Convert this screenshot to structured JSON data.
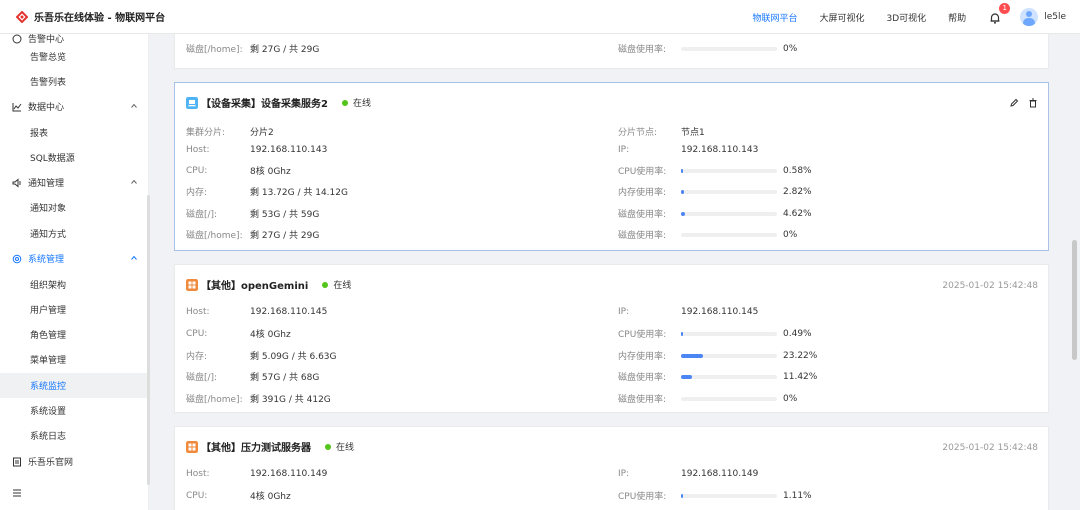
{
  "header": {
    "brand": "乐吾乐在线体验 - 物联网平台",
    "nav": [
      "物联网平台",
      "大屏可视化",
      "3D可视化",
      "帮助"
    ],
    "active_nav": 0,
    "notifications": "1",
    "username": "le5le"
  },
  "sidebar": {
    "groups": [
      {
        "label": "告警中心",
        "items": [
          "告警总览",
          "告警列表"
        ]
      },
      {
        "label": "数据中心",
        "items": [
          "报表",
          "SQL数据源"
        ]
      },
      {
        "label": "通知管理",
        "items": [
          "通知对象",
          "通知方式"
        ]
      },
      {
        "label": "系统管理",
        "items": [
          "组织架构",
          "用户管理",
          "角色管理",
          "菜单管理",
          "系统监控",
          "系统设置",
          "系统日志"
        ]
      },
      {
        "label": "乐吾乐官网",
        "items": []
      }
    ]
  },
  "labels": {
    "cluster": "集群分片:",
    "node": "分片节点:",
    "host": "Host:",
    "ip": "IP:",
    "cpu": "CPU:",
    "cpu_usage": "CPU使用率:",
    "mem": "内存:",
    "mem_usage": "内存使用率:",
    "disk_root": "磁盘[/]:",
    "disk_home": "磁盘[/home]:",
    "disk_usage": "磁盘使用率:",
    "online": "在线"
  },
  "card0": {
    "disk_home": "剩 27G  /  共 29G",
    "disk_home_pct": "0%",
    "disk_home_fill": 0
  },
  "card1": {
    "title": "【设备采集】设备采集服务2",
    "status": "在线",
    "cluster": "分片2",
    "node": "节点1",
    "host": "192.168.110.143",
    "ip": "192.168.110.143",
    "cpu": "8核  0Ghz",
    "cpu_pct": "0.58%",
    "cpu_fill": 0.0058,
    "mem": "剩 13.72G  /  共 14.12G",
    "mem_pct": "2.82%",
    "mem_fill": 0.0282,
    "disk_root": "剩 53G  /  共 59G",
    "disk_root_pct": "4.62%",
    "disk_root_fill": 0.0462,
    "disk_home": "剩 27G  /  共 29G",
    "disk_home_pct": "0%",
    "disk_home_fill": 0
  },
  "card2": {
    "title": "【其他】openGemini",
    "status": "在线",
    "time": "2025-01-02 15:42:48",
    "host": "192.168.110.145",
    "ip": "192.168.110.145",
    "cpu": "4核  0Ghz",
    "cpu_pct": "0.49%",
    "cpu_fill": 0.0049,
    "mem": "剩 5.09G  /  共 6.63G",
    "mem_pct": "23.22%",
    "mem_fill": 0.2322,
    "disk_root": "剩 57G  /  共 68G",
    "disk_root_pct": "11.42%",
    "disk_root_fill": 0.1142,
    "disk_home": "剩 391G  /  共 412G",
    "disk_home_pct": "0%",
    "disk_home_fill": 0
  },
  "card3": {
    "title": "【其他】压力测试服务器",
    "status": "在线",
    "time": "2025-01-02 15:42:48",
    "host": "192.168.110.149",
    "ip": "192.168.110.149",
    "cpu": "4核  0Ghz",
    "cpu_pct": "1.11%",
    "cpu_fill": 0.0111
  },
  "colors": {
    "accent": "#1677ff",
    "online": "#52c41a",
    "bar": "#4c86f5",
    "service_icon": "#4fb3f6",
    "other_icon": "#f08a3c"
  }
}
